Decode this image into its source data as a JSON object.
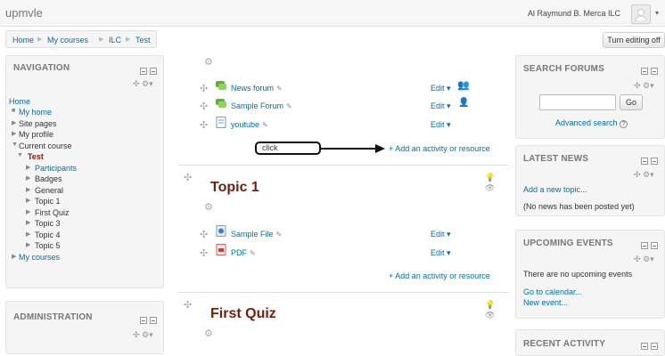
{
  "header": {
    "brand": "upmvle",
    "user": "Al Raymund B. Merca ILC",
    "edit_button": "Turn editing off"
  },
  "breadcrumb": [
    "Home",
    "My courses",
    "ILC",
    "Test"
  ],
  "navigation": {
    "title": "NAVIGATION",
    "home": "Home",
    "items": [
      "My home",
      "Site pages",
      "My profile",
      "Current course",
      "Test",
      "Participants",
      "Badges",
      "General",
      "Topic 1",
      "First Quiz",
      "Topic 3",
      "Topic 4",
      "Topic 5",
      "My courses"
    ]
  },
  "administration": {
    "title": "ADMINISTRATION"
  },
  "main": {
    "section0": {
      "activities": [
        {
          "name": "News forum",
          "edit": "Edit"
        },
        {
          "name": "Sample Forum",
          "edit": "Edit"
        },
        {
          "name": "youtube",
          "edit": "Edit"
        }
      ],
      "add": "Add an activity or resource",
      "callout": "click"
    },
    "topic1": {
      "title": "Topic 1",
      "activities": [
        {
          "name": "Sample File",
          "edit": "Edit"
        },
        {
          "name": "PDF",
          "edit": "Edit"
        }
      ],
      "add": "Add an activity or resource"
    },
    "topic2": {
      "title": "First Quiz"
    }
  },
  "search_forums": {
    "title": "SEARCH FORUMS",
    "go": "Go",
    "advanced": "Advanced search"
  },
  "latest_news": {
    "title": "LATEST NEWS",
    "add": "Add a new topic...",
    "empty": "(No news has been posted yet)"
  },
  "upcoming": {
    "title": "UPCOMING EVENTS",
    "empty": "There are no upcoming events",
    "calendar": "Go to calendar...",
    "new_event": "New event..."
  },
  "recent": {
    "title": "RECENT ACTIVITY"
  },
  "colors": {
    "topic_title": "#7a1b0c",
    "link": "#0070a8"
  }
}
